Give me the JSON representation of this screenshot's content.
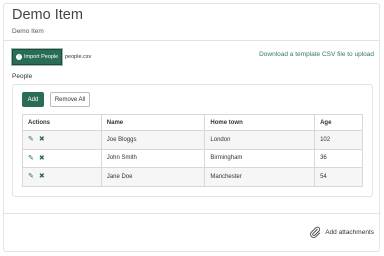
{
  "header": {
    "title": "Demo Item",
    "subtitle": "Demo Item"
  },
  "import": {
    "button_label": "Import People",
    "button_icon": "upload-icon",
    "filename": "people.csv",
    "template_link": "Download a template CSV file to upload"
  },
  "people": {
    "label": "People",
    "add_label": "Add",
    "remove_all_label": "Remove All",
    "columns": [
      "Actions",
      "Name",
      "Home town",
      "Age"
    ],
    "rows": [
      {
        "name": "Joe Bloggs",
        "home_town": "London",
        "age": "102"
      },
      {
        "name": "John Smith",
        "home_town": "Birmingham",
        "age": "36"
      },
      {
        "name": "Jane Doe",
        "home_town": "Manchester",
        "age": "54"
      }
    ],
    "row_action_icons": [
      "pencil-icon",
      "close-icon"
    ]
  },
  "footer": {
    "attachments_label": "Add attachments",
    "attachments_icon": "paperclip-icon"
  },
  "colors": {
    "accent": "#2a6d57",
    "link": "#2f7b5c",
    "border": "#e2e2e2"
  }
}
